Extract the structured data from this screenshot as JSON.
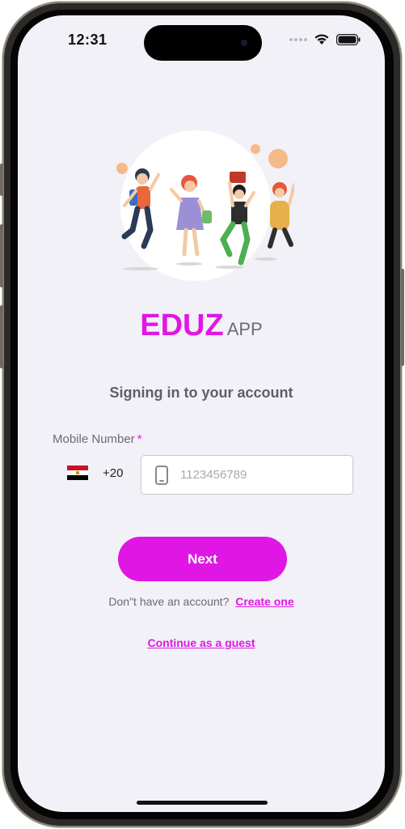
{
  "status_bar": {
    "time": "12:31"
  },
  "brand": {
    "main": "EDUZ",
    "sub": "APP"
  },
  "subtitle": "Signing in to your account",
  "mobile_field": {
    "label": "Mobile Number",
    "required_marker": "*",
    "country_code": "+20",
    "flag_icon": "egypt-flag-icon",
    "placeholder": "1123456789",
    "value": ""
  },
  "next_button": {
    "label": "Next"
  },
  "signup_prompt": {
    "text": "Don\"t have an account?",
    "link": "Create one"
  },
  "guest_link": "Continue as a guest",
  "colors": {
    "accent": "#e017e4",
    "background": "#f2f1f7",
    "text_muted": "#6a6a78"
  }
}
